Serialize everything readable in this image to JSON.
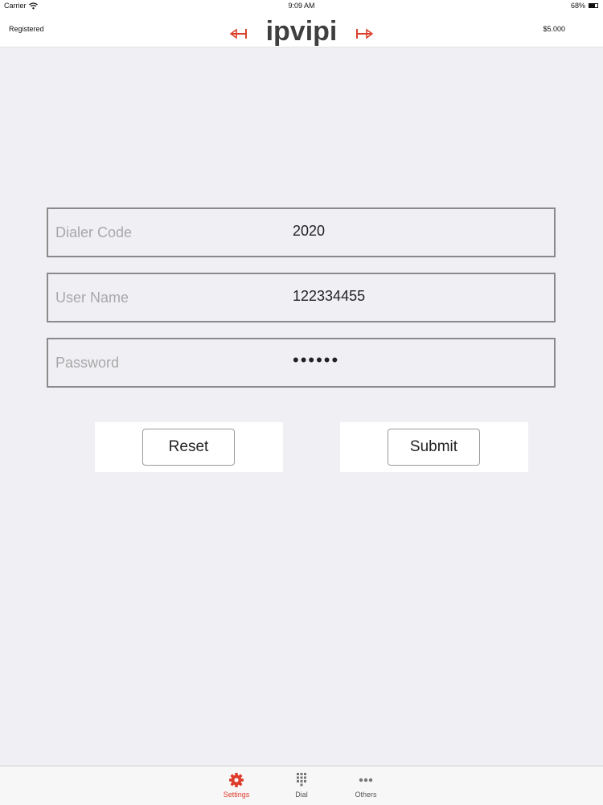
{
  "status_bar": {
    "carrier": "Carrier",
    "time": "9:09 AM",
    "battery": "68%",
    "battery_level": 0.68,
    "wifi_icon": "wifi-icon",
    "battery_icon": "battery-icon"
  },
  "header": {
    "registration_status": "Registered",
    "logo_text": "ipvipi",
    "balance": "$5.000",
    "logo_color": "#3f3f3f",
    "logo_accent": "#d9402b"
  },
  "form": {
    "dialer_code": {
      "label": "Dialer Code",
      "value": "2020"
    },
    "user_name": {
      "label": "User Name",
      "value": "122334455"
    },
    "password": {
      "label": "Password",
      "value": "••••••"
    }
  },
  "buttons": {
    "reset_label": "Reset",
    "submit_label": "Submit"
  },
  "tab_bar": {
    "active_color": "#e03a2a",
    "items": [
      {
        "label": "Settings",
        "icon": "gear-icon",
        "active": true
      },
      {
        "label": "Dial",
        "icon": "keypad-icon",
        "active": false
      },
      {
        "label": "Others",
        "icon": "more-icon",
        "active": false
      }
    ]
  }
}
